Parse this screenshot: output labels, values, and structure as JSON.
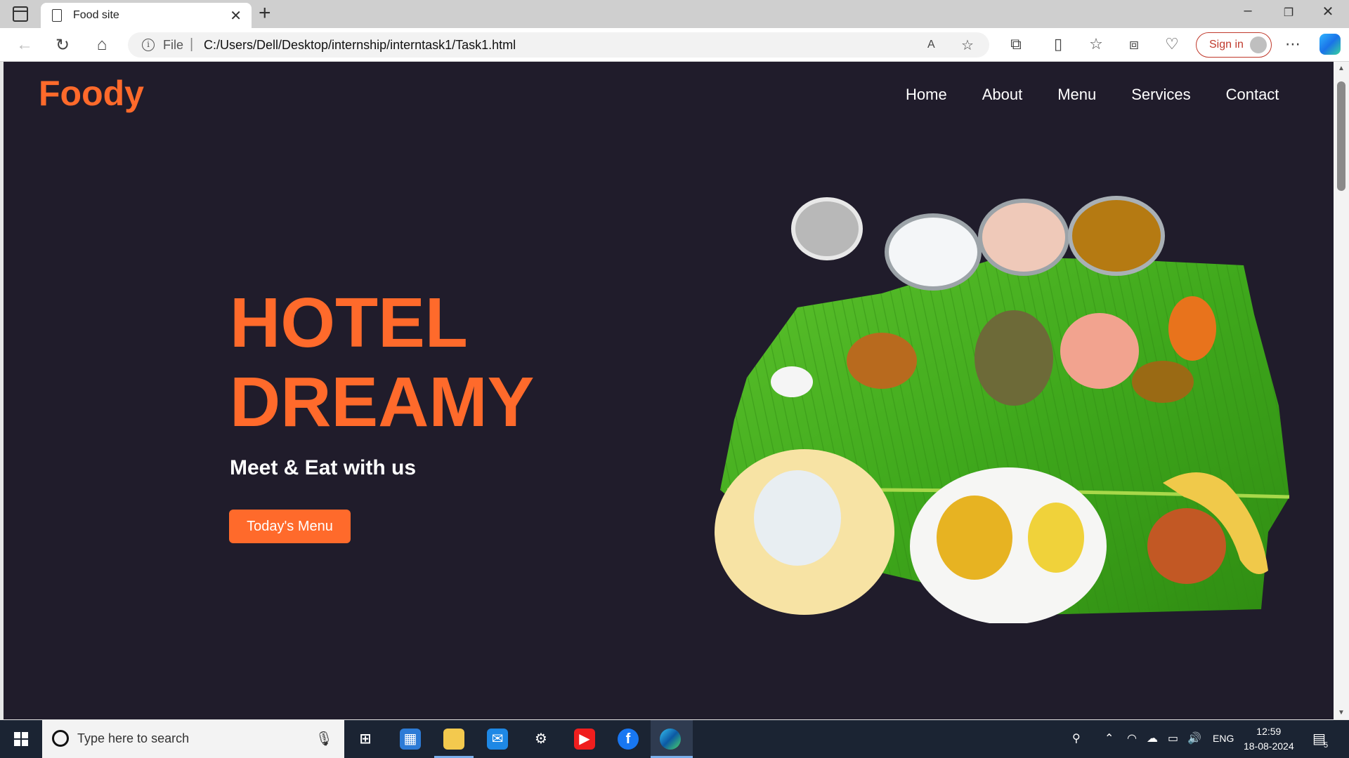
{
  "browser": {
    "tab_title": "Food site",
    "url_scheme": "File",
    "url": "C:/Users/Dell/Desktop/internship/interntask1/Task1.html",
    "signin_label": "Sign in"
  },
  "page": {
    "logo": "Foody",
    "nav": [
      "Home",
      "About",
      "Menu",
      "Services",
      "Contact"
    ],
    "hero_title_line1": "HOTEL",
    "hero_title_line2": "DREAMY",
    "hero_subtitle": "Meet & Eat with us",
    "cta_label": "Today's Menu",
    "image_subject": "banana-leaf-meal"
  },
  "taskbar": {
    "search_placeholder": "Type here to search",
    "language": "ENG",
    "time": "12:59",
    "date": "18-08-2024",
    "notification_count": "5"
  },
  "colors": {
    "page_bg": "#201c2b",
    "accent": "#ff6a2b"
  }
}
